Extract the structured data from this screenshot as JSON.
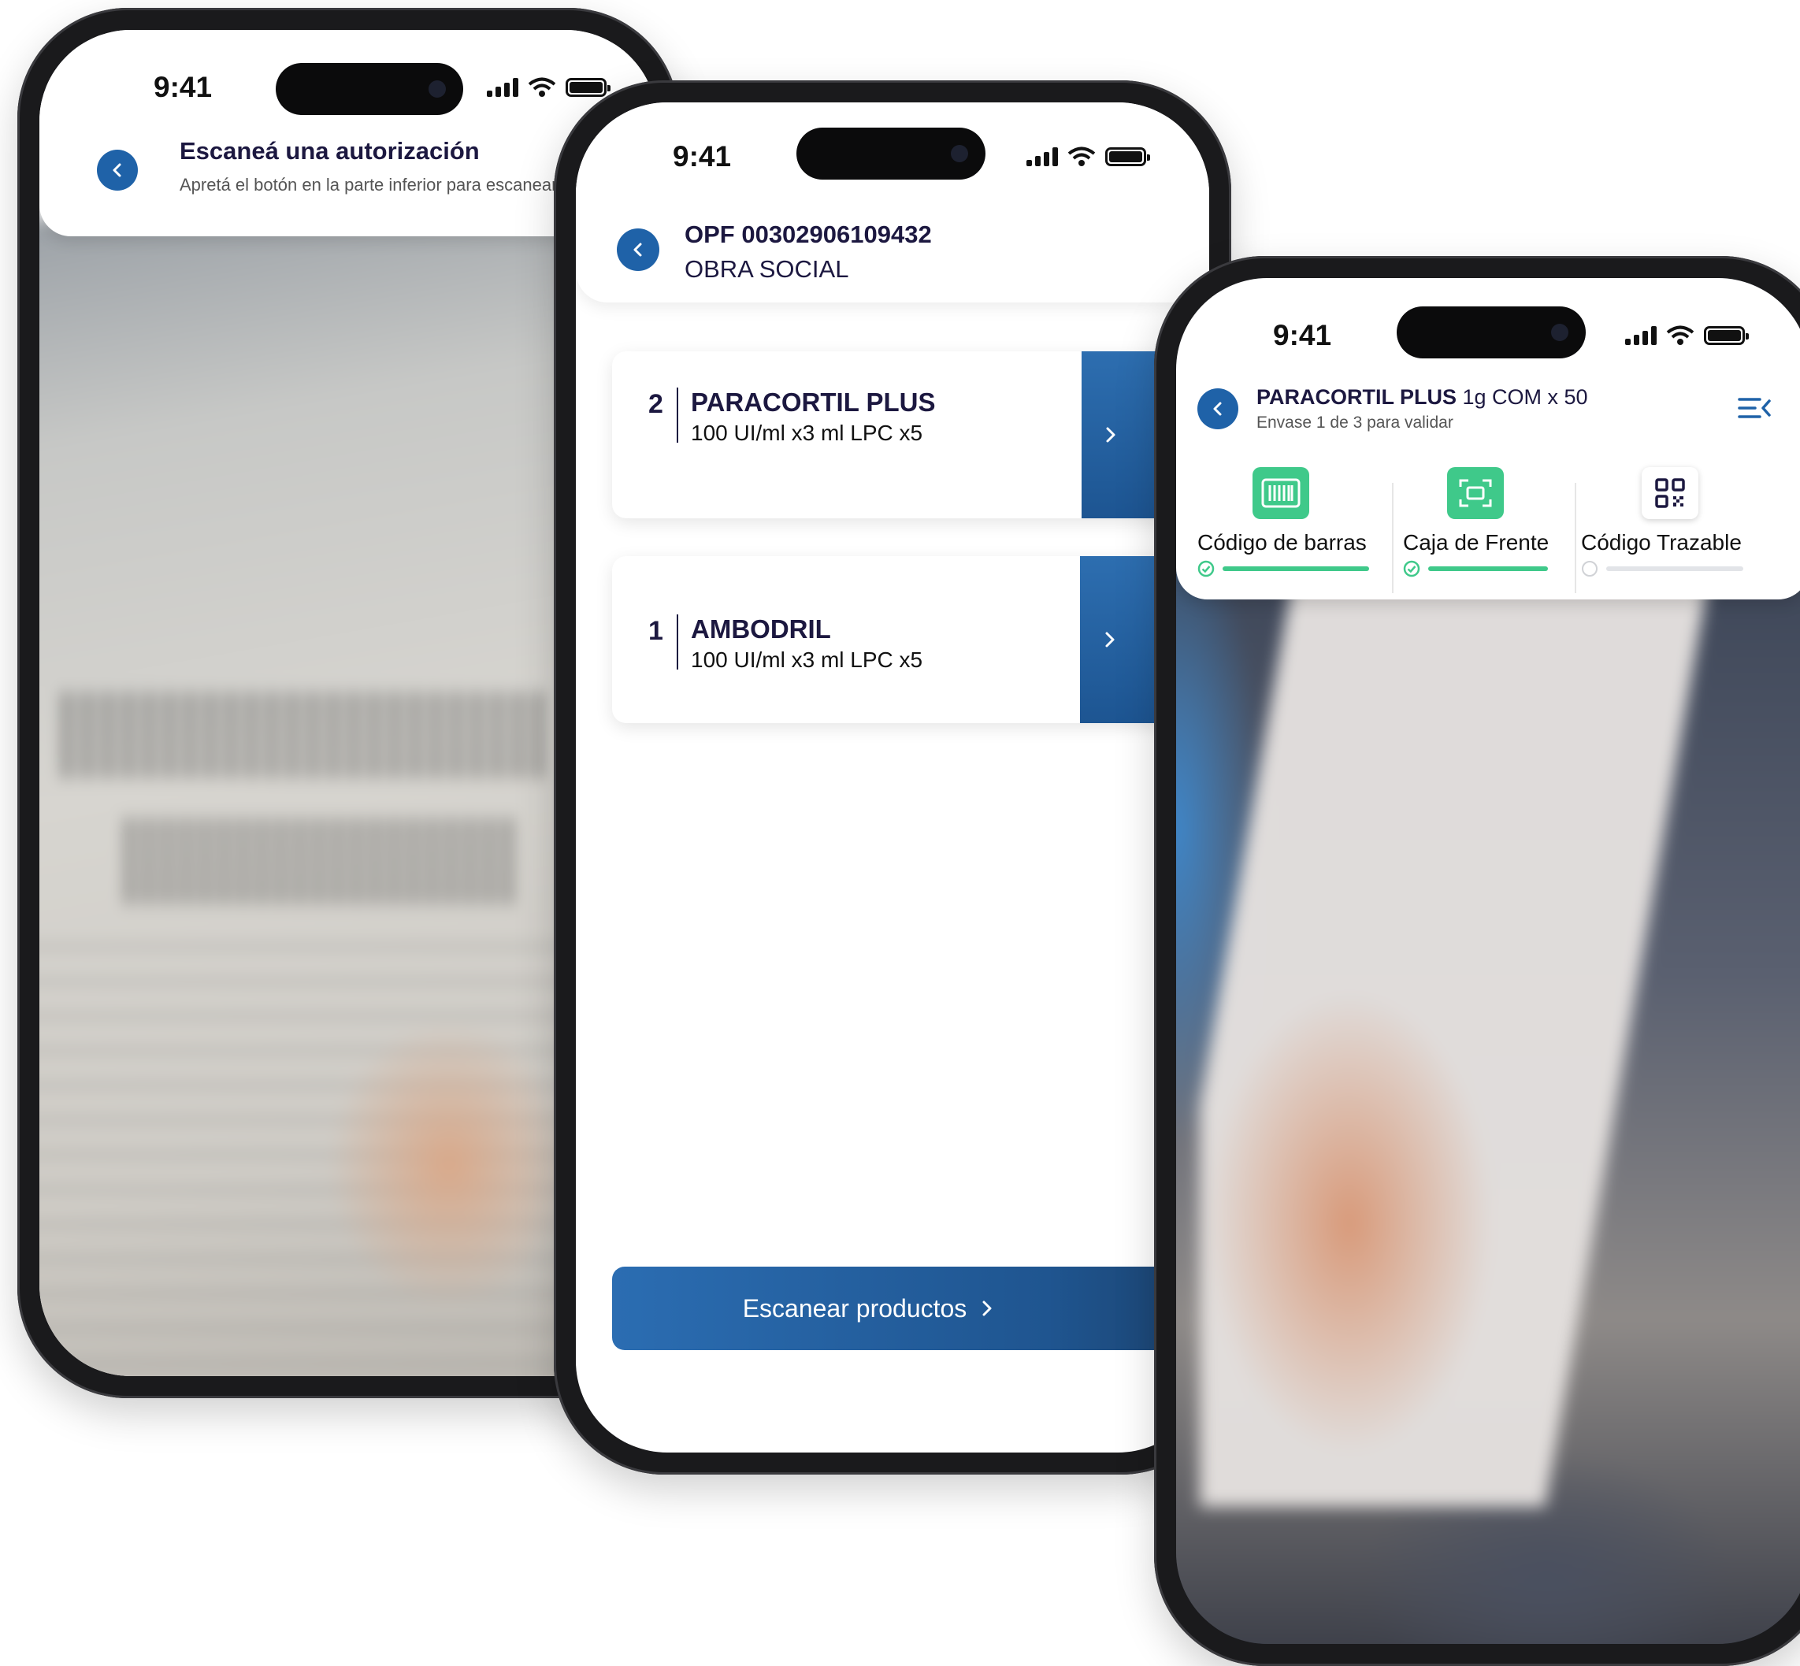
{
  "status": {
    "time": "9:41"
  },
  "phone1": {
    "title": "Escaneá una autorización",
    "subtitle": "Apretá el botón en la parte inferior para escanear"
  },
  "phone2": {
    "title": "OPF 00302906109432",
    "subtitle": "OBRA SOCIAL",
    "items": [
      {
        "qty": "2",
        "name": "PARACORTIL PLUS",
        "desc": "100 UI/ml x3 ml LPC x5"
      },
      {
        "qty": "1",
        "name": "AMBODRIL",
        "desc": "100 UI/ml x3 ml LPC x5"
      }
    ],
    "cta_label": "Escanear productos"
  },
  "phone3": {
    "product_name": "PARACORTIL PLUS",
    "product_detail": " 1g COM x 50",
    "subtitle": "Envase 1 de 3 para validar",
    "steps": [
      {
        "label": "Código de barras",
        "icon": "barcode-icon",
        "done": true
      },
      {
        "label": "Caja de Frente",
        "icon": "box-front-icon",
        "done": true
      },
      {
        "label": "Código Trazable",
        "icon": "qr-code-icon",
        "done": false
      }
    ]
  },
  "colors": {
    "brand_blue": "#1f62a8",
    "navy_text": "#1c1840",
    "success_green": "#3fc98a",
    "pending_gray": "#e2e4e8"
  }
}
